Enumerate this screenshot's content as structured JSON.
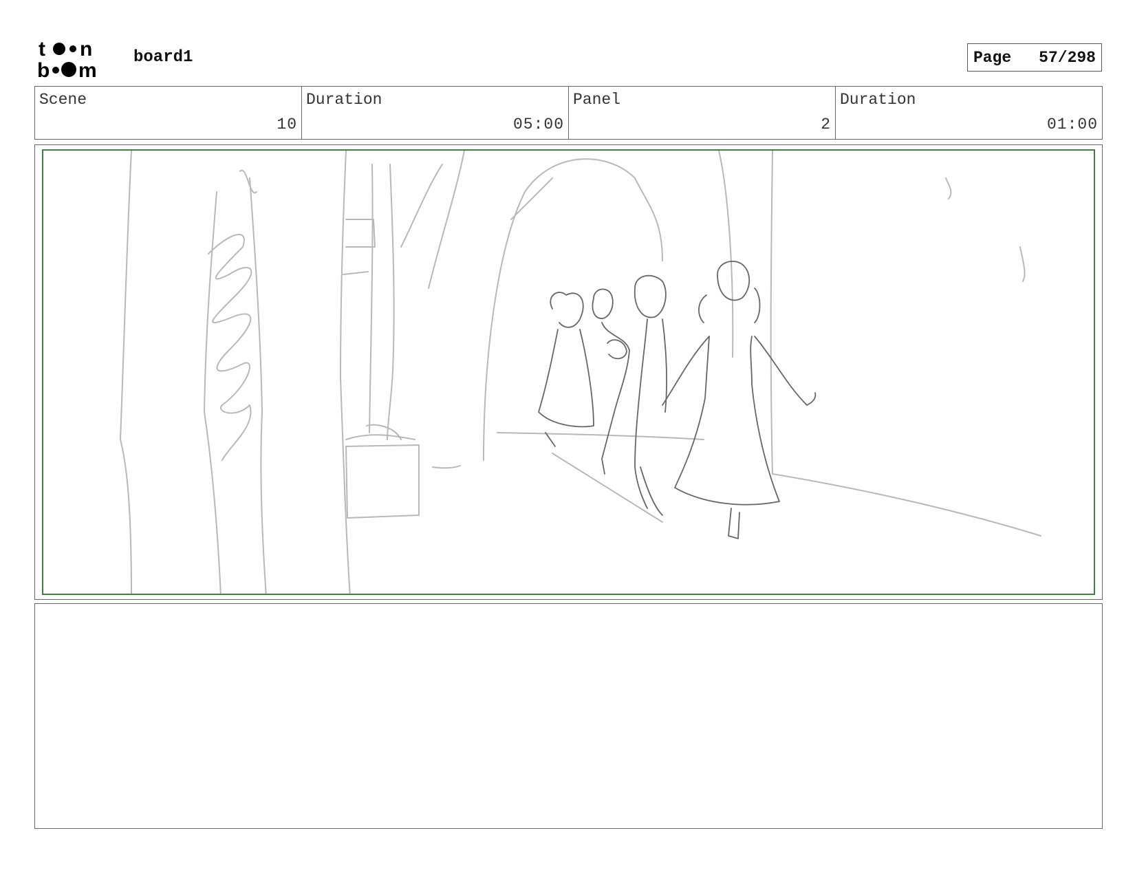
{
  "header": {
    "logo_text_top": "toon",
    "logo_text_bottom": "boom",
    "board_title": "board1",
    "page_label": "Page",
    "page_value": "57/298"
  },
  "info": {
    "scene_label": "Scene",
    "scene_value": "10",
    "scene_duration_label": "Duration",
    "scene_duration_value": "05:00",
    "panel_label": "Panel",
    "panel_value": "2",
    "panel_duration_label": "Duration",
    "panel_duration_value": "01:00"
  },
  "colors": {
    "safe_frame": "#3f7f3f",
    "sketch_light": "#b5b5b5",
    "sketch_dark": "#555555"
  },
  "notes": {
    "text": ""
  }
}
